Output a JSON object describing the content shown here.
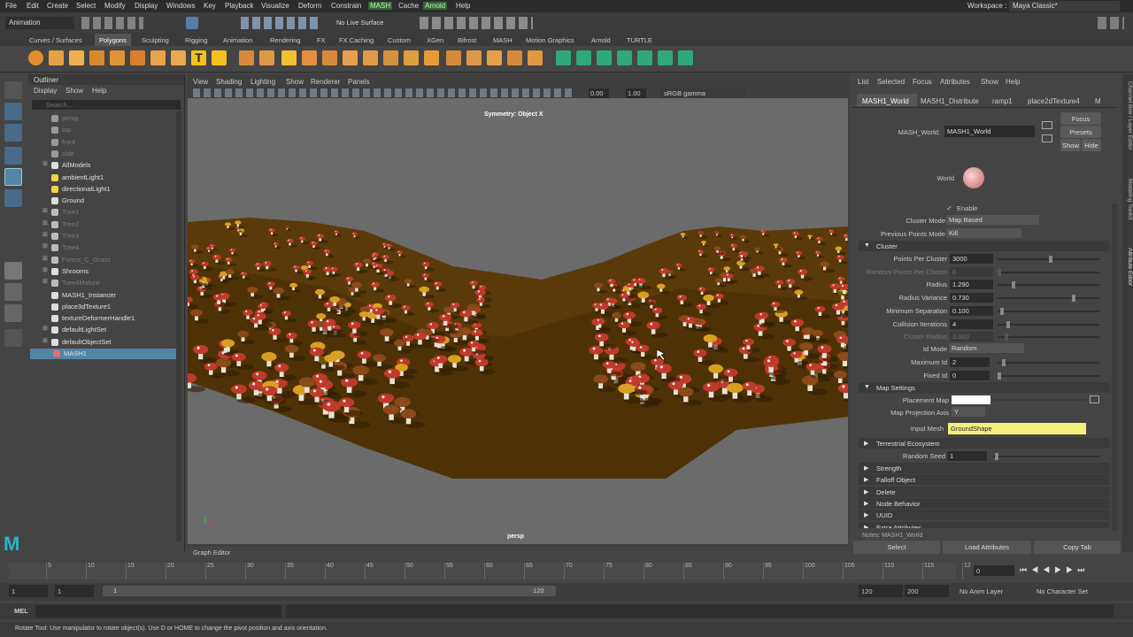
{
  "menubar": {
    "items": [
      "File",
      "Edit",
      "Create",
      "Select",
      "Modify",
      "Display",
      "Windows",
      "Key",
      "Playback",
      "Visualize",
      "Deform",
      "Constrain",
      "MASH",
      "Cache",
      "Arnold",
      "Help"
    ],
    "workspace_label": "Workspace :",
    "workspace_value": "Maya Classic*"
  },
  "status": {
    "mode": "Animation",
    "live_surface": "No Live Surface"
  },
  "shelf_tabs": [
    "Curves / Surfaces",
    "Polygons",
    "Sculpting",
    "Rigging",
    "Animation",
    "Rendering",
    "FX",
    "FX Caching",
    "Custom",
    "XGen",
    "Bifrost",
    "MASH",
    "Motion Graphics",
    "Arnold",
    "TURTLE"
  ],
  "outliner": {
    "title": "Outliner",
    "menus": [
      "Display",
      "Show",
      "Help"
    ],
    "search_placeholder": "Search...",
    "items": [
      "persp",
      "top",
      "front",
      "side",
      "AllModels",
      "ambientLight1",
      "directionalLight1",
      "Ground",
      "Tree1",
      "Tree2",
      "Tree3",
      "Tree4",
      "Forest_C_Grass",
      "Shrooms",
      "Tree4Mature",
      "MASH1_Instancer",
      "place3dTexture1",
      "textureDeformerHandle1",
      "defaultLightSet",
      "defaultObjectSet",
      "MASH1"
    ]
  },
  "viewport": {
    "menus": [
      "View",
      "Shading",
      "Lighting",
      "Show",
      "Renderer",
      "Panels"
    ],
    "val1": "0.00",
    "val2": "1.00",
    "colorspace": "sRGB gamma",
    "symmetry": "Symmetry: Object X",
    "camera": "persp",
    "graph_editor": "Graph Editor"
  },
  "attr": {
    "menus": [
      "List",
      "Selected",
      "Focus",
      "Attributes",
      "Show",
      "Help"
    ],
    "tabs": [
      "MASH1_World",
      "MASH1_Distribute",
      "ramp1",
      "place2dTexture4",
      "M"
    ],
    "node_label": "MASH_World:",
    "node_value": "MASH1_World",
    "focus": "Focus",
    "presets": "Presets",
    "show": "Show",
    "hide": "Hide",
    "world_label": "World",
    "enable": "Enable",
    "cluster_mode_label": "Cluster Mode",
    "cluster_mode": "Map Based",
    "prev_points_label": "Previous Points Mode",
    "prev_points": "Kill",
    "cluster_section": "Cluster",
    "fields": [
      {
        "label": "Points Per Cluster",
        "value": "3000"
      },
      {
        "label": "Random Points Per Cluster",
        "value": "0"
      },
      {
        "label": "Radius",
        "value": "1.290"
      },
      {
        "label": "Radius Variance",
        "value": "0.730"
      },
      {
        "label": "Minimum Separation",
        "value": "0.100"
      },
      {
        "label": "Collision Iterations",
        "value": "4"
      },
      {
        "label": "Cluster Radius",
        "value": "3.000"
      }
    ],
    "id_mode_label": "Id Mode",
    "id_mode": "Random",
    "max_id_label": "Maximum Id",
    "max_id": "2",
    "fixed_id_label": "Fixed Id",
    "fixed_id": "0",
    "map_section": "Map Settings",
    "placement_label": "Placement Map",
    "proj_label": "Map Projection Axis",
    "proj": "Y",
    "input_label": "Input Mesh",
    "input_mesh": "GroundShape",
    "terr_section": "Terrestrial Ecosystem",
    "seed_label": "Random Seed",
    "seed": "1",
    "sections": [
      "Strength",
      "Falloff Object",
      "Delete",
      "Node Behavior",
      "UUID",
      "Extra Attributes"
    ],
    "notes": "Notes: MASH1_World",
    "buttons": [
      "Select",
      "Load Attributes",
      "Copy Tab"
    ],
    "side_tabs": [
      "Channel Box / Layer Editor",
      "Modeling Toolkit",
      "Attribute Editor"
    ]
  },
  "timeline": {
    "ticks": [
      "5",
      "10",
      "15",
      "20",
      "25",
      "30",
      "35",
      "40",
      "45",
      "50",
      "55",
      "60",
      "65",
      "70",
      "75",
      "80",
      "85",
      "90",
      "95",
      "100",
      "105",
      "110",
      "115",
      "12"
    ],
    "current": "0"
  },
  "range": {
    "start": "1",
    "start2": "1",
    "slider_start": "1",
    "slider_end": "120",
    "end": "120",
    "end2": "200",
    "anim_layer": "No Anim Layer",
    "char_set": "No Character Set"
  },
  "mel": {
    "label": "MEL"
  },
  "help": {
    "text": "Rotate Tool: Use manipulator to rotate object(s). Use D or HOME to change the pivot position and axis orientation."
  },
  "colors": {
    "selected": "#5285a6",
    "highlight": "#f5f07a",
    "mushroom_red": "#c03a2a",
    "ground": "#5a3a08"
  }
}
